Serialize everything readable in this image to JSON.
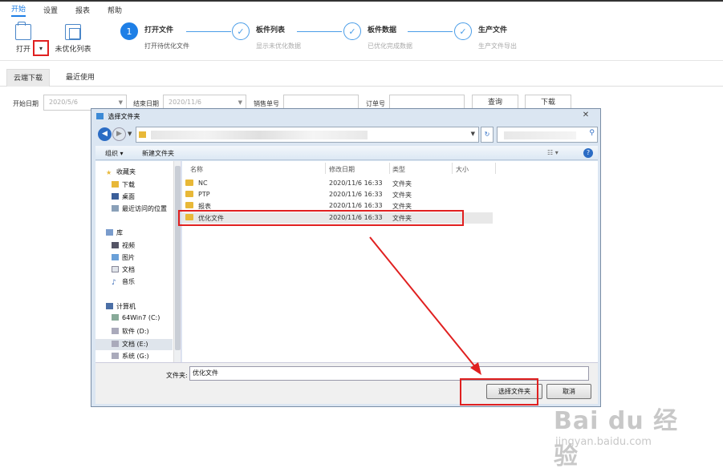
{
  "menu": [
    "开始",
    "设置",
    "报表",
    "帮助"
  ],
  "ribbon": {
    "open_label": "打开",
    "dropdown_glyph": "▾",
    "unoptimized_label": "未优化列表"
  },
  "steps": [
    {
      "num": "1",
      "title": "打开文件",
      "sub": "打开待优化文件"
    },
    {
      "num": "✓",
      "title": "板件列表",
      "sub": "显示未优化数据"
    },
    {
      "num": "✓",
      "title": "板件数据",
      "sub": "已优化完成数据"
    },
    {
      "num": "✓",
      "title": "生产文件",
      "sub": "生产文件导出"
    }
  ],
  "tabs": [
    "云端下载",
    "最近使用"
  ],
  "filters": {
    "start_label": "开始日期",
    "start_value": "2020/5/6",
    "end_label": "结束日期",
    "end_value": "2020/11/6",
    "order_label": "销售单号",
    "order2_label": "订单号",
    "query_btn": "查询",
    "download_btn": "下载"
  },
  "dialog": {
    "title": "选择文件夹",
    "close": "✕",
    "organize": "组织 ▾",
    "new_folder": "新建文件夹",
    "view_glyph": "☷ ▾",
    "help": "?",
    "nav": {
      "favorites": "收藏夹",
      "downloads": "下载",
      "desktop": "桌面",
      "recent": "最近访问的位置",
      "library": "库",
      "videos": "视频",
      "pictures": "图片",
      "documents": "文档",
      "music": "音乐",
      "computer": "计算机",
      "drive_c": "64Win7 (C:)",
      "drive_d": "软件 (D:)",
      "drive_e": "文档 (E:)",
      "drive_g": "系统 (G:)"
    },
    "columns": [
      "名称",
      "修改日期",
      "类型",
      "大小"
    ],
    "rows": [
      {
        "name": "NC",
        "date": "2020/11/6 16:33",
        "type": "文件夹"
      },
      {
        "name": "PTP",
        "date": "2020/11/6 16:33",
        "type": "文件夹"
      },
      {
        "name": "报表",
        "date": "2020/11/6 16:33",
        "type": "文件夹"
      },
      {
        "name": "优化文件",
        "date": "2020/11/6 16:33",
        "type": "文件夹"
      }
    ],
    "folder_label": "文件夹:",
    "folder_value": "优化文件",
    "select_btn": "选择文件夹",
    "cancel_btn": "取消"
  },
  "watermark": {
    "logo": "Bai du 经验",
    "url": "jingyan.baidu.com"
  },
  "colors": {
    "accent": "#1e7fe6",
    "highlight": "#e02020"
  }
}
